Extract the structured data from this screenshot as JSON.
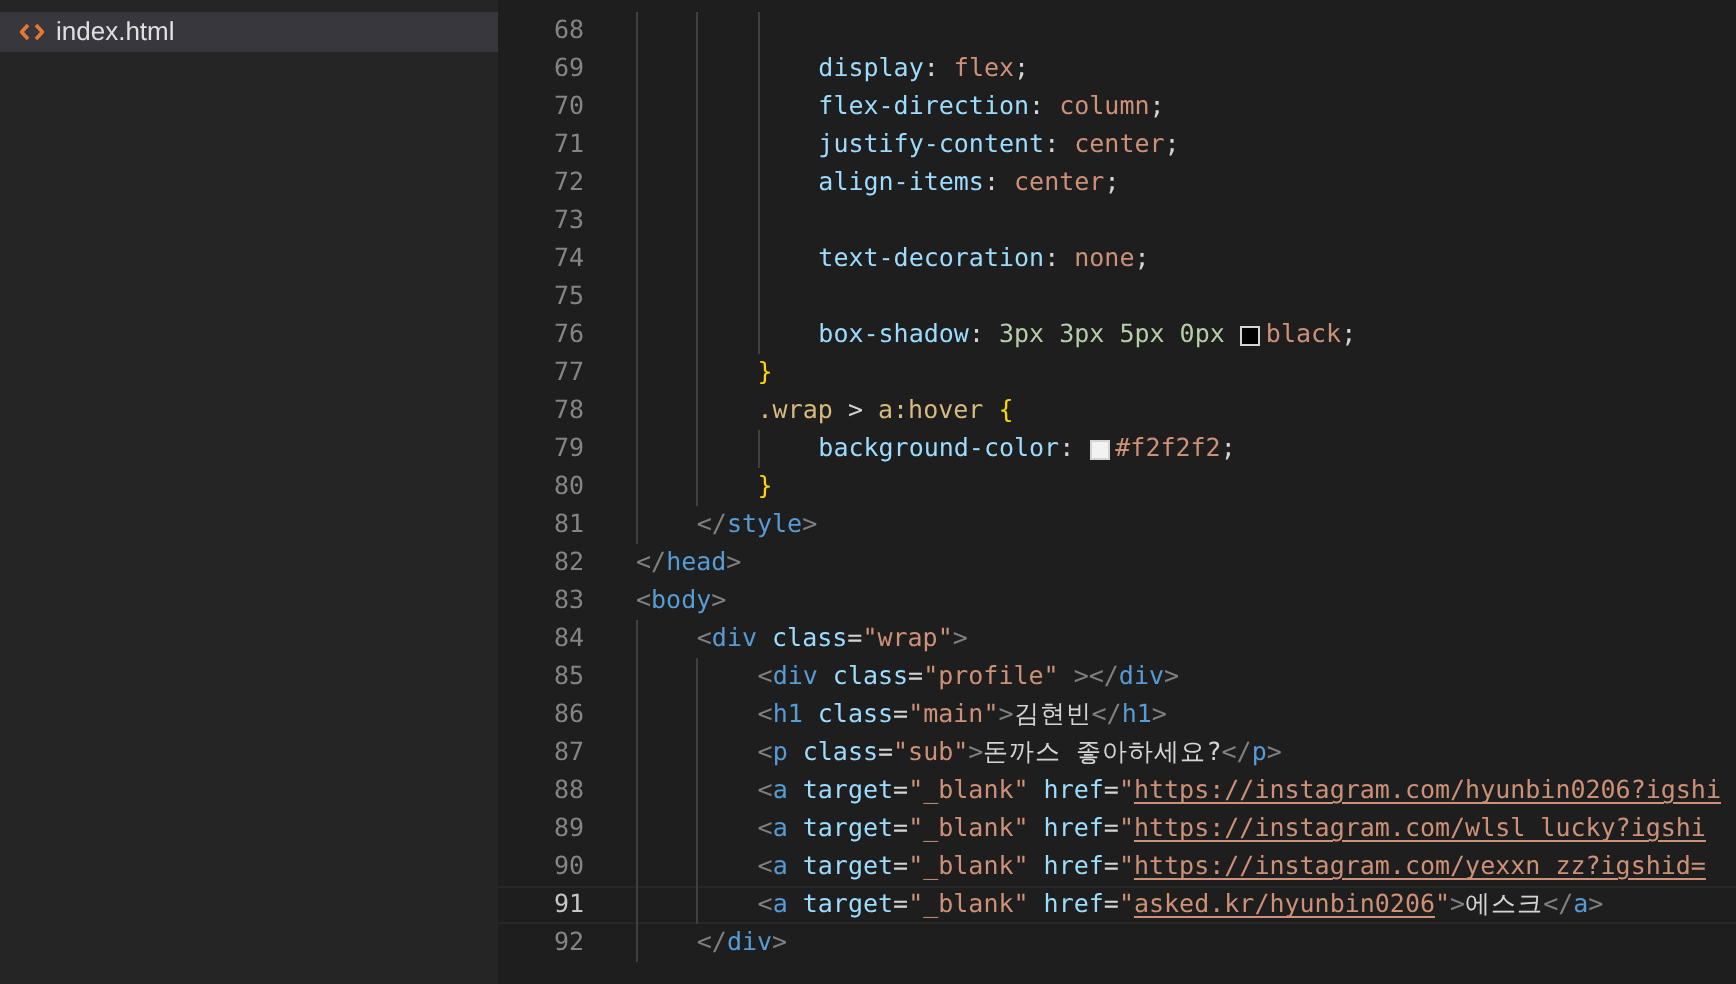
{
  "sidebar": {
    "items": [
      {
        "name": "index.html",
        "selected": true
      }
    ]
  },
  "editor": {
    "lines": [
      {
        "children": [
          {
            "children": [
              {
                "children": [
                  {
                    "number": "68",
                    "current": false
                  },
                  {
                    "number": "69",
                    "current": false,
                    "tokens": [
                      {
                        "kind": "k",
                        "text": "display"
                      },
                      {
                        "kind": "x",
                        "text": ":"
                      },
                      {
                        "kind": "v",
                        "text": "flex"
                      },
                      {
                        "kind": "x",
                        "text": ";"
                      }
                    ]
                  },
                  {
                    "number": "70",
                    "current": false,
                    "tokens": [
                      {
                        "kind": "k",
                        "text": "flex-direction"
                      },
                      {
                        "kind": "x",
                        "text": ":"
                      },
                      {
                        "kind": "v",
                        "text": "column"
                      },
                      {
                        "kind": "x",
                        "text": ";"
                      }
                    ]
                  },
                  {
                    "number": "71",
                    "current": false,
                    "tokens": [
                      {
                        "kind": "k",
                        "text": "justify-content"
                      },
                      {
                        "kind": "x",
                        "text": ":"
                      },
                      {
                        "kind": "v",
                        "text": "center"
                      },
                      {
                        "kind": "x",
                        "text": ";"
                      }
                    ]
                  },
                  {
                    "number": "72",
                    "current": false,
                    "tokens": [
                      {
                        "kind": "k",
                        "text": "align-items"
                      },
                      {
                        "kind": "x",
                        "text": ":"
                      },
                      {
                        "kind": "v",
                        "text": "center"
                      },
                      {
                        "kind": "x",
                        "text": ";"
                      }
                    ]
                  },
                  {
                    "number": "73",
                    "current": false
                  },
                  {
                    "number": "74",
                    "current": false,
                    "tokens": [
                      {
                        "kind": "k",
                        "text": "text-decoration"
                      },
                      {
                        "kind": "x",
                        "text": ":"
                      },
                      {
                        "kind": "v",
                        "text": "none"
                      },
                      {
                        "kind": "x",
                        "text": ";"
                      }
                    ]
                  },
                  {
                    "number": "75",
                    "current": false
                  },
                  {
                    "number": "76",
                    "current": false,
                    "tokens": [
                      {
                        "kind": "k",
                        "text": "box-shadow"
                      },
                      {
                        "kind": "x",
                        "text": ":"
                      },
                      {
                        "kind": "n",
                        "text": "3px 3px 5px 0px"
                      },
                      {
                        "kind": "sw",
                        "color": "#000000"
                      },
                      {
                        "kind": "v",
                        "text": "black"
                      },
                      {
                        "kind": "x",
                        "text": ";"
                      }
                    ]
                  }
                ]
              },
              {
                "number": "77",
                "current": false,
                "tokens": [
                  {
                    "kind": "b",
                    "text": "}"
                  }
                ]
              },
              {
                "number": "78",
                "current": false,
                "tokens": [
                  {
                    "kind": "sel",
                    "text": ".wrap"
                  },
                  {
                    "kind": "x",
                    "text": ">"
                  },
                  {
                    "kind": "sel",
                    "text": "a:hover"
                  },
                  {
                    "kind": "b",
                    "text": "{"
                  }
                ],
                "children": [
                  {
                    "number": "79",
                    "current": false,
                    "tokens": [
                      {
                        "kind": "k",
                        "text": "background-color"
                      },
                      {
                        "kind": "x",
                        "text": ":"
                      },
                      {
                        "kind": "sw",
                        "color": "#f2f2f2"
                      },
                      {
                        "kind": "v",
                        "text": "#f2f2f2"
                      },
                      {
                        "kind": "x",
                        "text": ";"
                      }
                    ]
                  }
                ]
              },
              {
                "number": "80",
                "current": false,
                "tokens": [
                  {
                    "kind": "b",
                    "text": "}"
                  }
                ]
              }
            ]
          },
          {
            "number": "81",
            "current": false,
            "tokens": [
              {
                "kind": "p",
                "text": "</"
              },
              {
                "kind": "t",
                "text": "style"
              },
              {
                "kind": "p",
                "text": ">"
              }
            ]
          }
        ]
      },
      {
        "number": "82",
        "current": false,
        "tokens": [
          {
            "kind": "p",
            "text": "</"
          },
          {
            "kind": "t",
            "text": "head"
          },
          {
            "kind": "p",
            "text": ">"
          }
        ]
      },
      {
        "number": "83",
        "current": false,
        "tokens": [
          {
            "kind": "p",
            "text": "<"
          },
          {
            "kind": "t",
            "text": "body"
          },
          {
            "kind": "p",
            "text": ">"
          }
        ],
        "children": [
          {
            "number": "84",
            "current": false,
            "tokens": [
              {
                "kind": "p",
                "text": "<"
              },
              {
                "kind": "t",
                "text": "div"
              },
              {
                "kind": "a",
                "text": "class"
              },
              {
                "kind": "x",
                "text": "="
              },
              {
                "kind": "s",
                "text": "\"wrap\""
              },
              {
                "kind": "p",
                "text": ">"
              }
            ],
            "children": [
              {
                "number": "85",
                "current": false,
                "tokens": [
                  {
                    "kind": "p",
                    "text": "<"
                  },
                  {
                    "kind": "t",
                    "text": "div"
                  },
                  {
                    "kind": "a",
                    "text": "class"
                  },
                  {
                    "kind": "x",
                    "text": "="
                  },
                  {
                    "kind": "s",
                    "text": "\"profile\""
                  },
                  {
                    "kind": "p",
                    "text": "></"
                  },
                  {
                    "kind": "t",
                    "text": "div"
                  },
                  {
                    "kind": "p",
                    "text": ">"
                  }
                ]
              },
              {
                "number": "86",
                "current": false,
                "tokens": [
                  {
                    "kind": "p",
                    "text": "<"
                  },
                  {
                    "kind": "t",
                    "text": "h1"
                  },
                  {
                    "kind": "a",
                    "text": "class"
                  },
                  {
                    "kind": "x",
                    "text": "="
                  },
                  {
                    "kind": "s",
                    "text": "\"main\""
                  },
                  {
                    "kind": "p",
                    "text": ">"
                  },
                  {
                    "kind": "x",
                    "text": "김현빈"
                  },
                  {
                    "kind": "p",
                    "text": "</"
                  },
                  {
                    "kind": "t",
                    "text": "h1"
                  },
                  {
                    "kind": "p",
                    "text": ">"
                  }
                ]
              },
              {
                "number": "87",
                "current": false,
                "tokens": [
                  {
                    "kind": "p",
                    "text": "<"
                  },
                  {
                    "kind": "t",
                    "text": "p"
                  },
                  {
                    "kind": "a",
                    "text": "class"
                  },
                  {
                    "kind": "x",
                    "text": "="
                  },
                  {
                    "kind": "s",
                    "text": "\"sub\""
                  },
                  {
                    "kind": "p",
                    "text": ">"
                  },
                  {
                    "kind": "x",
                    "text": "돈까스 좋아하세요?"
                  },
                  {
                    "kind": "p",
                    "text": "</"
                  },
                  {
                    "kind": "t",
                    "text": "p"
                  },
                  {
                    "kind": "p",
                    "text": ">"
                  }
                ]
              },
              {
                "number": "88",
                "current": false,
                "tokens": [
                  {
                    "kind": "p",
                    "text": "<"
                  },
                  {
                    "kind": "t",
                    "text": "a"
                  },
                  {
                    "kind": "a",
                    "text": "target"
                  },
                  {
                    "kind": "x",
                    "text": "="
                  },
                  {
                    "kind": "s",
                    "text": "\"_blank\""
                  },
                  {
                    "kind": "a",
                    "text": "href"
                  },
                  {
                    "kind": "x",
                    "text": "="
                  },
                  {
                    "kind": "s",
                    "text": "\""
                  },
                  {
                    "kind": "l",
                    "text": "https://instagram.com/hyunbin0206?igshi"
                  }
                ]
              },
              {
                "number": "89",
                "current": false,
                "tokens": [
                  {
                    "kind": "p",
                    "text": "<"
                  },
                  {
                    "kind": "t",
                    "text": "a"
                  },
                  {
                    "kind": "a",
                    "text": "target"
                  },
                  {
                    "kind": "x",
                    "text": "="
                  },
                  {
                    "kind": "s",
                    "text": "\"_blank\""
                  },
                  {
                    "kind": "a",
                    "text": "href"
                  },
                  {
                    "kind": "x",
                    "text": "="
                  },
                  {
                    "kind": "s",
                    "text": "\""
                  },
                  {
                    "kind": "l",
                    "text": "https://instagram.com/wlsl_lucky?igshi"
                  }
                ]
              },
              {
                "number": "90",
                "current": false,
                "tokens": [
                  {
                    "kind": "p",
                    "text": "<"
                  },
                  {
                    "kind": "t",
                    "text": "a"
                  },
                  {
                    "kind": "a",
                    "text": "target"
                  },
                  {
                    "kind": "x",
                    "text": "="
                  },
                  {
                    "kind": "s",
                    "text": "\"_blank\""
                  },
                  {
                    "kind": "a",
                    "text": "href"
                  },
                  {
                    "kind": "x",
                    "text": "="
                  },
                  {
                    "kind": "s",
                    "text": "\""
                  },
                  {
                    "kind": "l",
                    "text": "https://instagram.com/yexxn_zz?igshid="
                  }
                ]
              },
              {
                "number": "91",
                "current": true,
                "tokens": [
                  {
                    "kind": "p",
                    "text": "<"
                  },
                  {
                    "kind": "t",
                    "text": "a"
                  },
                  {
                    "kind": "a",
                    "text": "target"
                  },
                  {
                    "kind": "x",
                    "text": "="
                  },
                  {
                    "kind": "s",
                    "text": "\"_blank\""
                  },
                  {
                    "kind": "a",
                    "text": "href"
                  },
                  {
                    "kind": "x",
                    "text": "="
                  },
                  {
                    "kind": "s",
                    "text": "\""
                  },
                  {
                    "kind": "l",
                    "text": "asked.kr/hyunbin0206"
                  },
                  {
                    "kind": "s",
                    "text": "\""
                  },
                  {
                    "kind": "p",
                    "text": ">"
                  },
                  {
                    "kind": "x",
                    "text": "에스크"
                  },
                  {
                    "kind": "p",
                    "text": "</"
                  },
                  {
                    "kind": "t",
                    "text": "a"
                  },
                  {
                    "kind": "p",
                    "text": ">"
                  }
                ]
              }
            ]
          },
          {
            "number": "92",
            "current": false,
            "tokens": [
              {
                "kind": "p",
                "text": "</"
              },
              {
                "kind": "t",
                "text": "div"
              },
              {
                "kind": "p",
                "text": ">"
              }
            ]
          }
        ]
      }
    ]
  }
}
